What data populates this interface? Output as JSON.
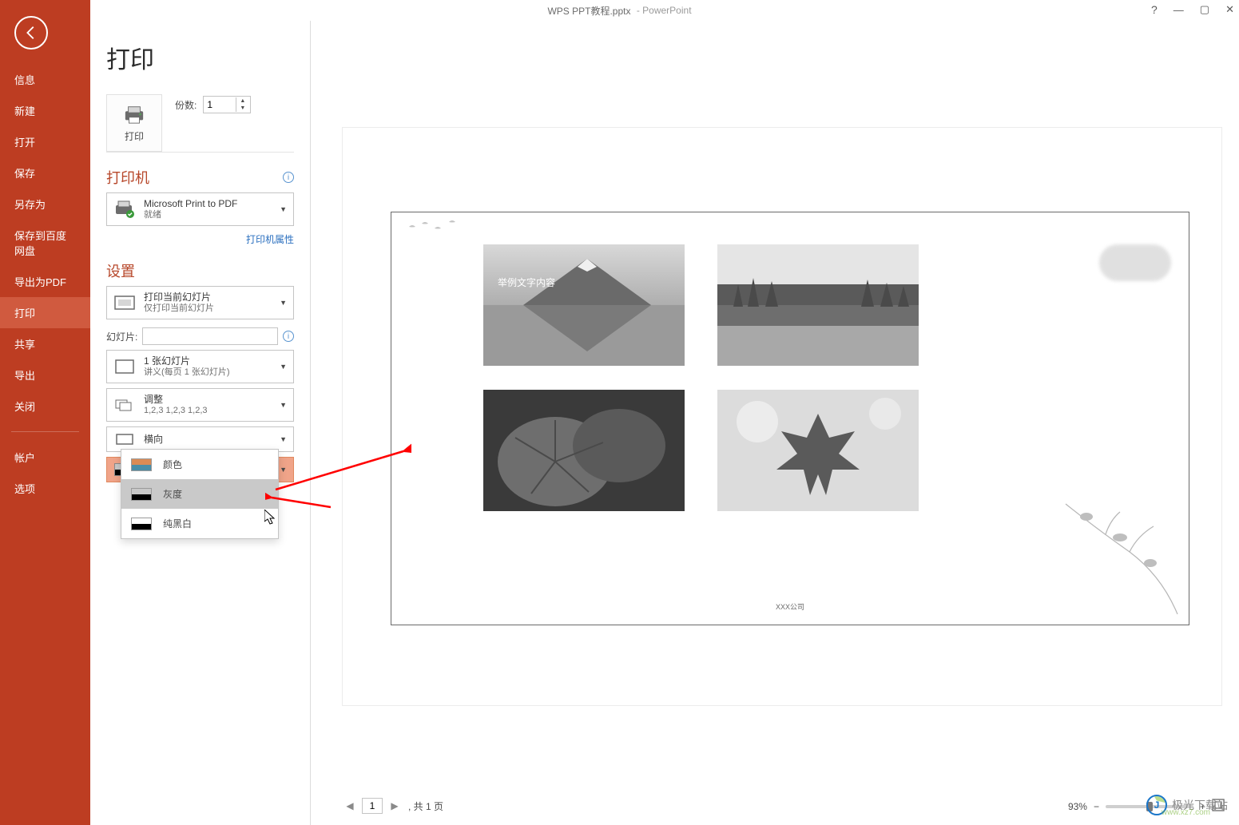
{
  "titlebar": {
    "file": "WPS PPT教程.pptx",
    "app": "PowerPoint"
  },
  "win": {
    "help": "?",
    "min": "—",
    "max": "▢",
    "close": "✕"
  },
  "sidebar": {
    "items": [
      {
        "label": "信息"
      },
      {
        "label": "新建"
      },
      {
        "label": "打开"
      },
      {
        "label": "保存"
      },
      {
        "label": "另存为"
      },
      {
        "label": "保存到百度网盘"
      },
      {
        "label": "导出为PDF"
      },
      {
        "label": "打印"
      },
      {
        "label": "共享"
      },
      {
        "label": "导出"
      },
      {
        "label": "关闭"
      }
    ],
    "account": "帐户",
    "options": "选项"
  },
  "page_title": "打印",
  "print_btn": "打印",
  "copies": {
    "label": "份数:",
    "value": "1"
  },
  "printer_section": {
    "title": "打印机",
    "name": "Microsoft Print to PDF",
    "status": "就绪",
    "props_link": "打印机属性"
  },
  "settings_section": {
    "title": "设置",
    "what": {
      "line1": "打印当前幻灯片",
      "line2": "仅打印当前幻灯片"
    },
    "slides_label": "幻灯片:",
    "layout": {
      "line1": "1 张幻灯片",
      "line2": "讲义(每页 1 张幻灯片)"
    },
    "collate": {
      "line1": "调整",
      "line2": "1,2,3    1,2,3    1,2,3"
    },
    "orient": {
      "line1": "横向"
    },
    "color_selected": "灰度",
    "color_options": [
      {
        "label": "颜色",
        "c": "linear-gradient(to bottom,#db8b55 0%,#db8b55 50%,#4a8ea8 50%)"
      },
      {
        "label": "灰度",
        "c": "linear-gradient(to bottom,#c8c8c8 0%,#c8c8c8 50%,#000 50%)"
      },
      {
        "label": "纯黑白",
        "c": "linear-gradient(to bottom,#fff 0%,#fff 50%,#000 50%)"
      }
    ]
  },
  "slide": {
    "caption": "举例文字内容",
    "company": "XXX公司"
  },
  "page_nav": {
    "current": "1",
    "total": "共 1 页"
  },
  "zoom": {
    "pct": "93%",
    "minus": "−",
    "plus": "+"
  },
  "watermark": {
    "name": "极光下载站",
    "url": "www.xz7.com"
  }
}
